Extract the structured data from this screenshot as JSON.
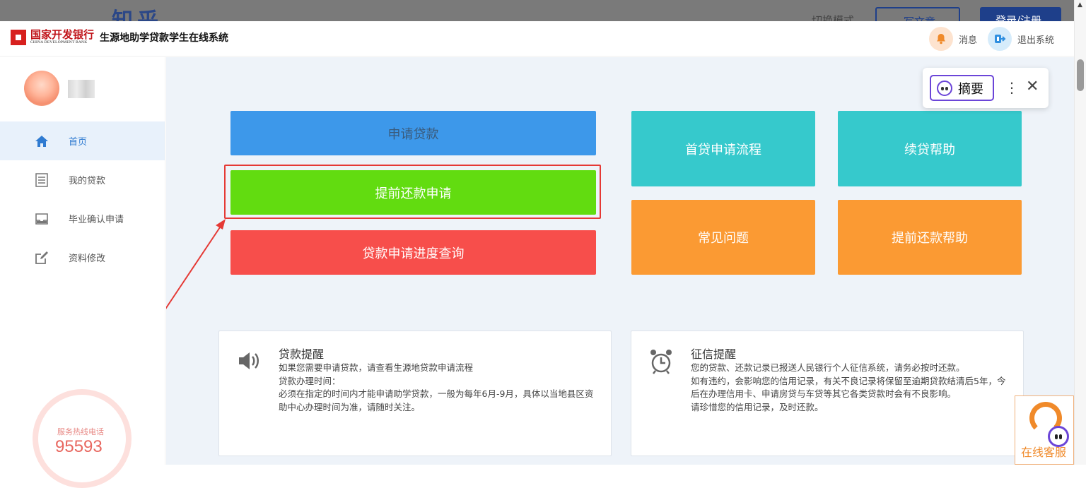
{
  "overlay": {
    "logo": "知乎",
    "mode": "切换模式",
    "write": "写文章",
    "login": "登录/注册"
  },
  "header": {
    "bank_cn": "国家开发银行",
    "bank_en": "CHINA DEVELOPMENT BANK",
    "system_title": "生源地助学贷款学生在线系统",
    "messages_label": "消息",
    "logout_label": "退出系统"
  },
  "sidebar": {
    "items": [
      {
        "label": "首页",
        "icon": "home-icon"
      },
      {
        "label": "我的贷款",
        "icon": "list-icon"
      },
      {
        "label": "毕业确认申请",
        "icon": "tray-icon"
      },
      {
        "label": "资料修改",
        "icon": "edit-icon"
      }
    ],
    "hotline_label": "服务热线电话",
    "hotline_number": "95593"
  },
  "tiles": {
    "apply": "申请贷款",
    "prepay": "提前还款申请",
    "progress": "贷款申请进度查询",
    "first_loan_flow": "首贷申请流程",
    "renew_help": "续贷帮助",
    "faq": "常见问题",
    "prepay_help": "提前还款帮助"
  },
  "cards": {
    "loan_notice": {
      "title": "贷款提醒",
      "lines": [
        "如果您需要申请贷款，请查看生源地贷款申请流程",
        "贷款办理时间：",
        "必须在指定的时间内才能申请助学贷款，一般为每年6月-9月，具体以当地县区资助中心办理时间为准，请随时关注。"
      ]
    },
    "credit_notice": {
      "title": "征信提醒",
      "lines": [
        "您的贷款、还款记录已报送人民银行个人征信系统，请务必按时还款。",
        "如有违约，会影响您的信用记录，有关不良记录将保留至逾期贷款结清后5年，今后在办理信用卡、申请房贷与车贷等其它各类贷款时会有不良影响。",
        "请珍惜您的信用记录，及时还款。"
      ]
    }
  },
  "ai_popup": {
    "summary_label": "摘要",
    "more": "⋮",
    "close": "✕"
  },
  "service": {
    "label": "在线客服"
  },
  "colors": {
    "blue_tile": "#3d98ea",
    "green_tile": "#62dc10",
    "red_tile": "#f74e4b",
    "teal_tile": "#36c9cc",
    "orange_tile": "#fb9a33",
    "highlight_red": "#e53935"
  }
}
